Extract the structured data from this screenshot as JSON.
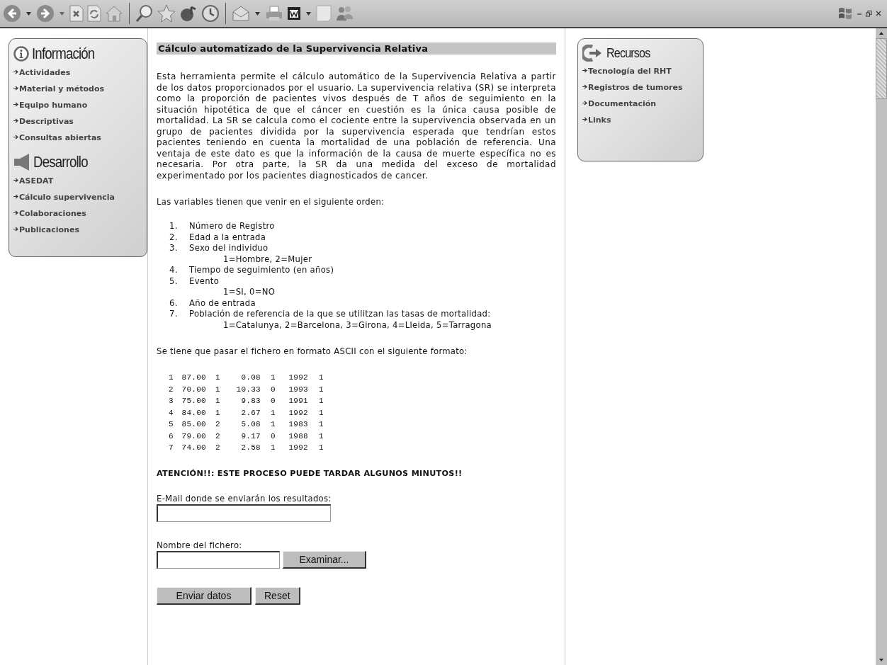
{
  "left_panel": {
    "sections": [
      {
        "kind": "info",
        "title": "Información",
        "items": [
          {
            "label": "Actividades"
          },
          {
            "label": "Material y métodos"
          },
          {
            "label": "Equipo humano"
          },
          {
            "label": "Descriptivas"
          },
          {
            "label": "Consultas abiertas"
          }
        ]
      },
      {
        "kind": "speaker",
        "title": "Desarrollo",
        "items": [
          {
            "label": "ASEDAT"
          },
          {
            "label": "Cálculo supervivencia"
          },
          {
            "label": "Colaboraciones"
          },
          {
            "label": "Publicaciones"
          }
        ]
      }
    ]
  },
  "main": {
    "title": "Cálculo automatizado de la Supervivencia Relativa",
    "intro": "Esta herramienta permite el cálculo automático de la Supervivencia Relativa a partir de los datos proporcionados por el usuario. La supervivencia relativa (SR) se interpreta como la proporción de pacientes vivos después de T años de seguimiento en la situación hipotética de que el cáncer en cuestión es la única causa posible de mortalidad. La SR se calcula como el cociente entre la supervivencia observada en un grupo de pacientes dividida por la supervivencia esperada que tendrían estos pacientes teniendo en cuenta la mortalidad de una población de referencia. Una ventaja de este dato es que la información de la causa de muerte específica no es necesaria. Por otra parte, la SR da una medida del exceso de mortalidad experimentado por los pacientes diagnosticados de cancer.",
    "variables_heading": "Las variables tienen que venir en el siguiente orden:",
    "variables": [
      {
        "number": "1.",
        "label": "Número de Registro"
      },
      {
        "number": "2.",
        "label": "Edad a la entrada"
      },
      {
        "number": "3.",
        "label": "Sexo del individuo",
        "note": "1=Hombre, 2=Mujer"
      },
      {
        "number": "4.",
        "label": "Tiempo de seguimiento (en años)"
      },
      {
        "number": "5.",
        "label": "Evento",
        "note": "1=SI, 0=NO"
      },
      {
        "number": "6.",
        "label": "Año de entrada"
      },
      {
        "number": "7.",
        "label": "Población de referencia de la que se utilitzan las tasas de mortalidad:",
        "note": "1=Catalunya, 2=Barcelona, 3=Girona, 4=Lleida, 5=Tarragona"
      }
    ],
    "format_heading": "Se tiene que pasar el fichero en formato ASCII con el siguiente formato:",
    "sample_rows": [
      [
        "1",
        "87.00",
        "1",
        "0.08",
        "1",
        "1992",
        "1"
      ],
      [
        "2",
        "70.00",
        "1",
        "10.33",
        "0",
        "1993",
        "1"
      ],
      [
        "3",
        "75.00",
        "1",
        "9.83",
        "0",
        "1991",
        "1"
      ],
      [
        "4",
        "84.00",
        "1",
        "2.67",
        "1",
        "1992",
        "1"
      ],
      [
        "5",
        "85.00",
        "2",
        "5.08",
        "1",
        "1983",
        "1"
      ],
      [
        "6",
        "79.00",
        "2",
        "9.17",
        "0",
        "1988",
        "1"
      ],
      [
        "7",
        "74.00",
        "2",
        "2.58",
        "1",
        "1992",
        "1"
      ]
    ],
    "warning": "ATENCIÓN!!: ESTE PROCESO PUEDE TARDAR ALGUNOS MINUTOS!!",
    "email_label": "E-Mail donde se enviarán los resultados:",
    "file_label": "Nombre del fichero:",
    "browse_button": "Examinar...",
    "buttons": [
      "Enviar datos",
      "Reset"
    ]
  },
  "right_panel": {
    "title": "Recursos",
    "items": [
      {
        "label": "Tecnología del RHT"
      },
      {
        "label": "Registros de tumores"
      },
      {
        "label": "Documentación"
      },
      {
        "label": "Links"
      }
    ]
  }
}
